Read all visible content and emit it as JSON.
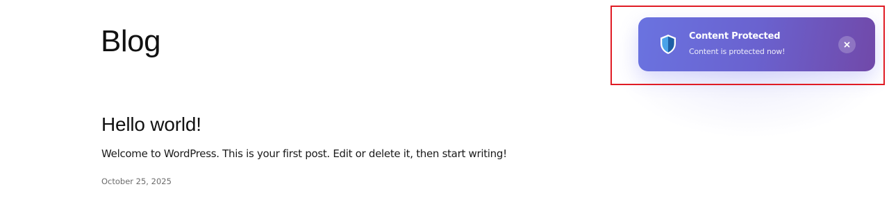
{
  "page": {
    "title": "Blog"
  },
  "post": {
    "title": "Hello world!",
    "excerpt": "Welcome to WordPress. This is your first post. Edit or delete it, then start writing!",
    "date": "October 25, 2025"
  },
  "toast": {
    "title": "Content Protected",
    "message": "Content is protected now!",
    "icon": "shield-icon",
    "close_icon": "close-icon",
    "gradient_start": "#6a73e0",
    "gradient_end": "#7149a9",
    "highlight_color": "#e01b24"
  }
}
